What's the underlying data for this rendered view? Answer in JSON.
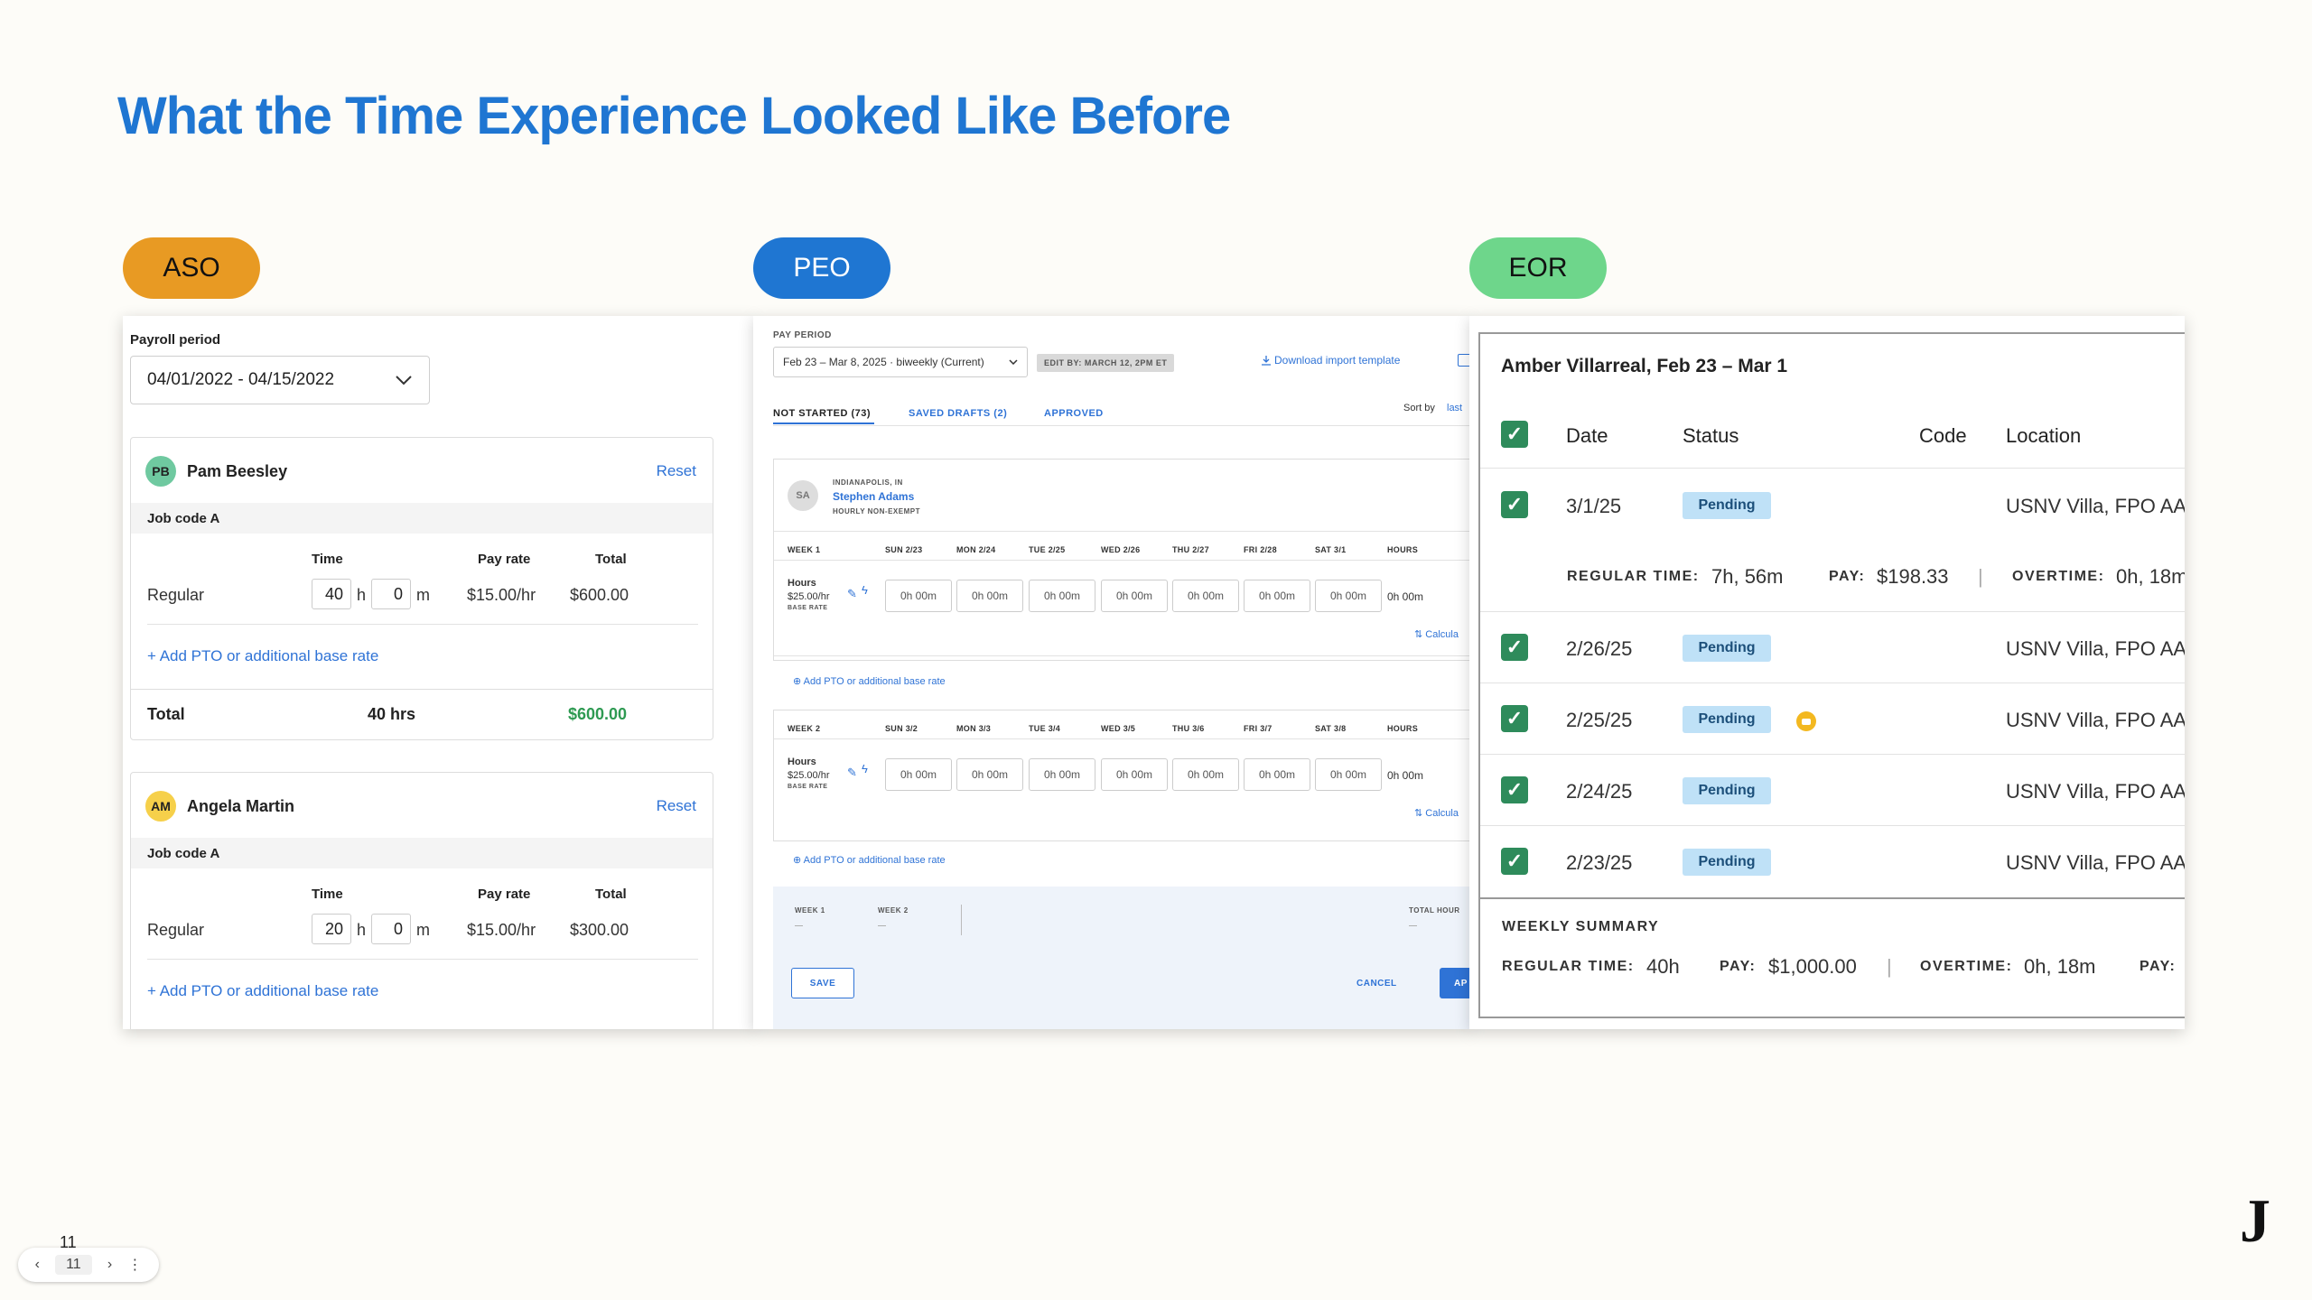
{
  "slide": {
    "title": "What the Time Experience Looked Like Before",
    "page_number": "11",
    "nav_page": "11",
    "logo": "J"
  },
  "pills": [
    {
      "label": "ASO",
      "color": "#e89a23"
    },
    {
      "label": "PEO",
      "color": "#1f76d2"
    },
    {
      "label": "EOR",
      "color": "#6ed68b"
    }
  ],
  "aso": {
    "payroll_label": "Payroll period",
    "period": "04/01/2022 - 04/15/2022",
    "employees": [
      {
        "initials": "PB",
        "name": "Pam Beesley",
        "reset": "Reset",
        "job_code": "Job code A",
        "col_time": "Time",
        "col_rate": "Pay rate",
        "col_total": "Total",
        "row_label": "Regular",
        "hours": "40",
        "h": "h",
        "minutes": "0",
        "m": "m",
        "rate": "$15.00/hr",
        "amount": "$600.00",
        "add_link": "+ Add PTO or additional base rate",
        "total_label": "Total",
        "total_hours": "40 hrs",
        "total_amount": "$600.00"
      },
      {
        "initials": "AM",
        "name": "Angela Martin",
        "reset": "Reset",
        "job_code": "Job code A",
        "col_time": "Time",
        "col_rate": "Pay rate",
        "col_total": "Total",
        "row_label": "Regular",
        "hours": "20",
        "h": "h",
        "minutes": "0",
        "m": "m",
        "rate": "$15.00/hr",
        "amount": "$300.00",
        "add_link": "+ Add PTO or additional base rate"
      }
    ]
  },
  "peo": {
    "pay_period_label": "PAY PERIOD",
    "period": "Feb 23 – Mar 8, 2025 · biweekly (Current)",
    "edit_by": "EDIT BY: MARCH 12, 2PM ET",
    "download": "Download import template",
    "sort_by": "Sort by",
    "sort_val": "last",
    "tabs": [
      "NOT STARTED (73)",
      "SAVED DRAFTS (2)",
      "APPROVED"
    ],
    "employee": {
      "initials": "SA",
      "location": "INDIANAPOLIS, IN",
      "name": "Stephen Adams",
      "type": "HOURLY NON-EXEMPT"
    },
    "weeks": [
      {
        "label": "WEEK 1",
        "days": [
          "SUN 2/23",
          "MON 2/24",
          "TUE 2/25",
          "WED 2/26",
          "THU 2/27",
          "FRI 2/28",
          "SAT 3/1"
        ],
        "hours_col": "HOURS",
        "row_label": "Hours",
        "rate": "$25.00/hr",
        "base": "BASE RATE",
        "cell": "0h 00m",
        "total": "0h 00m",
        "calc": "Calcula",
        "add": "Add PTO or additional base rate"
      },
      {
        "label": "WEEK 2",
        "days": [
          "SUN 3/2",
          "MON 3/3",
          "TUE 3/4",
          "WED 3/5",
          "THU 3/6",
          "FRI 3/7",
          "SAT 3/8"
        ],
        "hours_col": "HOURS",
        "row_label": "Hours",
        "rate": "$25.00/hr",
        "base": "BASE RATE",
        "cell": "0h 00m",
        "total": "0h 00m",
        "calc": "Calcula",
        "add": "Add PTO or additional base rate"
      }
    ],
    "footer": {
      "week1": "WEEK 1",
      "week2": "WEEK 2",
      "total_hours": "TOTAL HOUR",
      "dash": "—",
      "save": "SAVE",
      "cancel": "CANCEL",
      "approve": "AP"
    }
  },
  "eor": {
    "heading": "Amber Villarreal, Feb 23 – Mar 1",
    "columns": [
      "Date",
      "Status",
      "Code",
      "Location"
    ],
    "rows": [
      {
        "date": "3/1/25",
        "status": "Pending",
        "location": "USNV Villa, FPO AA"
      },
      {
        "date": "2/26/25",
        "status": "Pending",
        "location": "USNV Villa, FPO AA"
      },
      {
        "date": "2/25/25",
        "status": "Pending",
        "location": "USNV Villa, FPO AA"
      },
      {
        "date": "2/24/25",
        "status": "Pending",
        "location": "USNV Villa, FPO AA"
      },
      {
        "date": "2/23/25",
        "status": "Pending",
        "location": "USNV Villa, FPO AA"
      }
    ],
    "detail": {
      "reg_label": "REGULAR TIME:",
      "reg_val": "7h, 56m",
      "pay_label": "PAY:",
      "pay_val": "$198.33",
      "sep": "|",
      "ot_label": "OVERTIME:",
      "ot_val": "0h, 18m"
    },
    "summary": {
      "title": "WEEKLY SUMMARY",
      "reg_label": "REGULAR TIME:",
      "reg_val": "40h",
      "pay_label": "PAY:",
      "pay_val": "$1,000.00",
      "sep": "|",
      "ot_label": "OVERTIME:",
      "ot_val": "0h, 18m",
      "pay2_label": "PAY:"
    }
  }
}
